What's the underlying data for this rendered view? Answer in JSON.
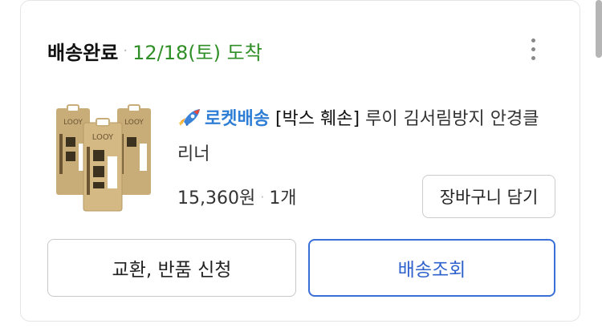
{
  "order": {
    "status": "배송완료",
    "separator": "·",
    "arrival": "12/18(토) 도착"
  },
  "product": {
    "badge": "로켓배송",
    "badge_icon": "rocket-icon",
    "tag": "[박스 훼손]",
    "name": "루이 김서림방지 안경클리너",
    "price": "15,360원",
    "quantity": "1개",
    "thumbnail_brand": "LOOY"
  },
  "buttons": {
    "cart": "장바구니 담기",
    "exchange": "교환, 반품 신청",
    "track": "배송조회"
  },
  "colors": {
    "arrival_green": "#2f8f26",
    "rocket_blue": "#2e7ed6",
    "track_blue": "#3a6fd8"
  }
}
